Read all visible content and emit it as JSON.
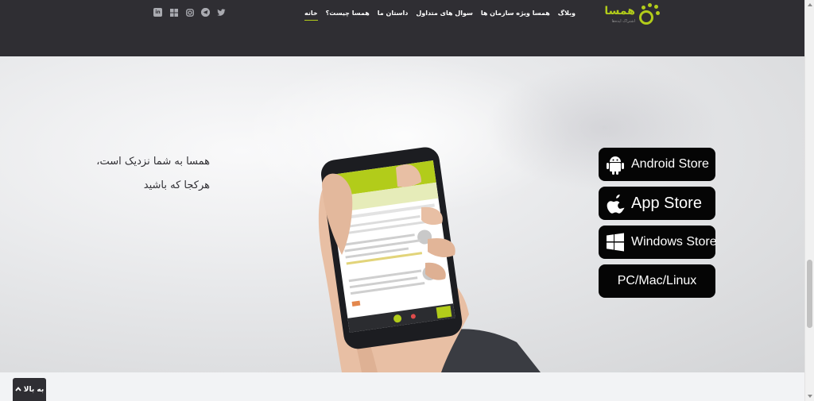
{
  "brand": {
    "name": "همسا",
    "tagline_small": "اشتراک ایده‌ها",
    "accent_color": "#b2cc1a",
    "header_color": "#2f2e33"
  },
  "nav": {
    "items": [
      {
        "label": "خانه",
        "active": true
      },
      {
        "label": "همسا چیست؟"
      },
      {
        "label": "داستان ما"
      },
      {
        "label": "سوال های متداول"
      },
      {
        "label": "همسا ویژه سازمان ها"
      },
      {
        "label": "وبلاگ"
      }
    ]
  },
  "social": {
    "icons": [
      "twitter-icon",
      "telegram-icon",
      "instagram-icon",
      "windows-icon",
      "linkedin-icon"
    ]
  },
  "hero": {
    "line1": "همسا به شما نزدیک است،",
    "line2": "هرکجا که باشید",
    "phone_image": "hand-holding-phone"
  },
  "stores": [
    {
      "label": "Android Store",
      "icon": "android-icon"
    },
    {
      "label": "App Store",
      "icon": "apple-icon"
    },
    {
      "label": "Windows Store",
      "icon": "windows-icon"
    },
    {
      "label": "PC/Mac/Linux",
      "icon": ""
    }
  ],
  "back_to_top": {
    "label": "به بالا"
  }
}
